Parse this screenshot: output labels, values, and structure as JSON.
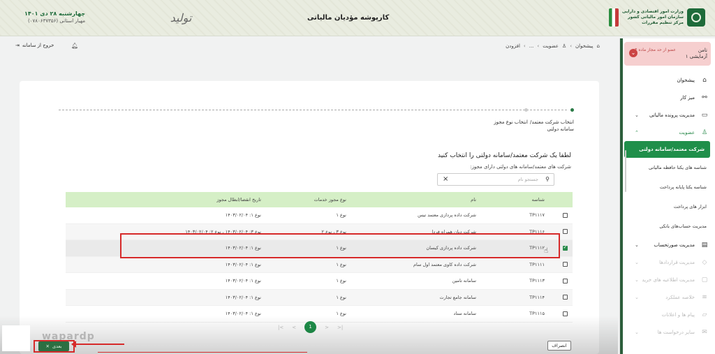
{
  "header": {
    "org_line1": "وزارت امور اقتصادی و دارایی",
    "org_line2": "سازمان امور مالیاتی کشور",
    "org_line3": "مرکز تنظیم مقررات",
    "app_title": "کارپوشه مؤدیان مالیاتی",
    "slogan": "تولید",
    "date": "چهارشنبه ۲۸ دی ۱۴۰۱",
    "user_line": "مهیار استانی (۰۷۸۰۶۳۷۳۵۶)"
  },
  "toolbar": {
    "logout_label": "خروج از سامانه",
    "breadcrumb": [
      "پیشخوان",
      "عضویت",
      "...",
      "افزودن"
    ]
  },
  "sidebar": {
    "user_name": "تامن آزمایشی ۱",
    "user_role": "عضو از حد مجاز ماده ۴",
    "items": [
      {
        "label": "پیشخوان",
        "icon": "home-icon"
      },
      {
        "label": "میز کار",
        "icon": "nodes-icon"
      },
      {
        "label": "مدیریت پرونده مالیاتی",
        "icon": "file-icon"
      },
      {
        "label": "عضویت",
        "icon": "user-icon"
      }
    ],
    "sub_items": [
      "شرکت معتمد/سامانه دولتی",
      "شناسه های یکتا حافظه مالیاتی",
      "شناسه یکتا پایانه پرداخت",
      "ابزار های پرداخت",
      "مدیریت حساب‌های بانکی"
    ],
    "lower_items": [
      {
        "label": "مدیریت صورتحساب",
        "icon": "receipt-icon"
      },
      {
        "label": "مدیریت قراردادها",
        "icon": "handshake-icon"
      },
      {
        "label": "مدیریت اطلاعیه های خرید",
        "icon": "clipboard-icon"
      },
      {
        "label": "خلاصه عملکرد",
        "icon": "chart-icon"
      },
      {
        "label": "پیام ها و اعلانات",
        "icon": "message-icon"
      },
      {
        "label": "سایر درخواست ها",
        "icon": "mail-icon"
      }
    ]
  },
  "steps": {
    "step1": "انتخاب شرکت معتمد/سامانه دولتی",
    "step2": "انتخاب نوع مجوز"
  },
  "content": {
    "heading": "لطفا یک شرکت معتمد/سامانه دولتی را انتخاب کنید",
    "subheading": "شرکت های معتمد/سامانه های دولتی دارای مجوز:",
    "search_placeholder": "جستجو نام"
  },
  "table": {
    "columns": [
      "شناسه",
      "نام",
      "نوع مجوز خدمات",
      "تاریخ انقضا/ابطال مجوز"
    ],
    "rows": [
      {
        "id": "TP۱۱۱۷",
        "name": "شرکت داده پردازی معتمد تیس",
        "type": "نوع ۱",
        "date": "نوع ۱: ۱۴۰۳/۰۲/۰۴",
        "checked": false
      },
      {
        "id": "TP۱۱۱۶",
        "name": "شرکت دیان همراه فردا",
        "type": "نوع ۳ ، نوع ۲",
        "date": "نوع ۳: ۱۴۰۳/۰۲/۰۴ ، نوع ۲: ۱۴۰۳/۰۲/۰۴",
        "checked": false
      },
      {
        "id": "TP۱۱۱۲",
        "name": "شرکت داده پردازی کیسان",
        "type": "نوع ۱",
        "date": "نوع ۱: ۱۴۰۳/۰۲/۰۴",
        "checked": true
      },
      {
        "id": "TP۱۱۱۱",
        "name": "شرکت داده کاوی معتمد اول سام",
        "type": "نوع ۱",
        "date": "نوع ۱: ۱۴۰۳/۰۲/۰۴",
        "checked": false
      },
      {
        "id": "TP۱۱۱۳",
        "name": "سامانه تامین",
        "type": "نوع ۱",
        "date": "نوع ۱: ۱۴۰۳/۰۲/۰۴",
        "checked": false
      },
      {
        "id": "TP۱۱۱۴",
        "name": "سامانه جامع تجارت",
        "type": "نوع ۱",
        "date": "نوع ۱: ۱۴۰۳/۰۲/۰۴",
        "checked": false
      },
      {
        "id": "TP۱۱۱۵",
        "name": "سامانه ستاد",
        "type": "نوع ۱",
        "date": "نوع ۱: ۱۴۰۳/۰۲/۰۴",
        "checked": false
      }
    ]
  },
  "pagination": {
    "current": "1",
    "first": "|<",
    "prev": "<",
    "next": ">",
    "last": ">|"
  },
  "footer": {
    "cancel_label": "انصراف",
    "next_label": "بعدی"
  },
  "watermark": "wapardp",
  "colors": {
    "primary": "#1f8f4a",
    "table_header": "#d5efc6",
    "highlight": "#d62a2a"
  }
}
